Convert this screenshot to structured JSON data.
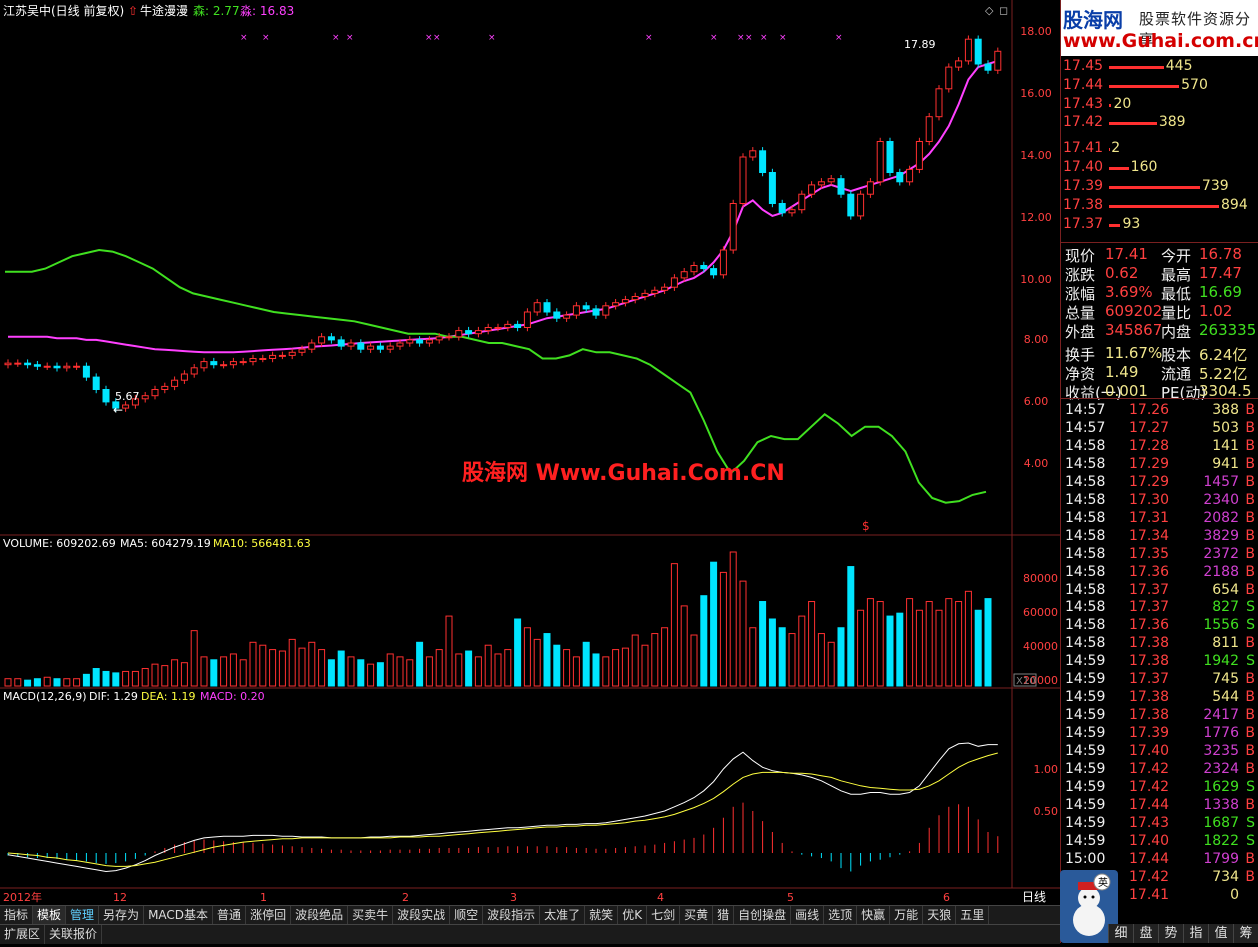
{
  "header": {
    "stock_name": "江苏吴中(日线 前复权)",
    "indicator_name": "牛途漫漫",
    "sen_label": "森: 2.77",
    "miao_label": "淼: 16.83"
  },
  "main_chart": {
    "y_ticks": [
      "18.00",
      "16.00",
      "14.00",
      "12.00",
      "10.00",
      "8.00",
      "6.00",
      "4.00"
    ],
    "low_label": "5.67",
    "high_label": "17.89",
    "watermark": "股海网 Www.Guhai.Com.CN",
    "dollar_mark": "$",
    "arrow_left": "←"
  },
  "volume_panel": {
    "label_prefix": "VOLUME: 609202.69",
    "ma5": "MA5: 604279.19",
    "ma10": "MA10: 566481.63",
    "y_ticks": [
      "80000",
      "60000",
      "40000",
      "20000"
    ],
    "unit": "X10"
  },
  "macd_panel": {
    "label": "MACD(12,26,9)",
    "dif": "DIF: 1.29",
    "dea": "DEA: 1.19",
    "macd": "MACD: 0.20",
    "y_ticks": [
      "1.00",
      "0.50"
    ]
  },
  "time_axis": [
    "2012年",
    "12",
    "1",
    "2",
    "3",
    "4",
    "5",
    "6"
  ],
  "period_label": "日线",
  "sidebar": {
    "logo_main": "股海网",
    "logo_tag": "股票软件资源分享",
    "logo_url": "www.Guhai.com.cn",
    "order_book": [
      {
        "price": "17.45",
        "vol": "445"
      },
      {
        "price": "17.44",
        "vol": "570"
      },
      {
        "price": "17.43",
        "vol": "20"
      },
      {
        "price": "17.42",
        "vol": "389"
      },
      {
        "price": "17.41",
        "vol": "2"
      },
      {
        "price": "17.40",
        "vol": "160"
      },
      {
        "price": "17.39",
        "vol": "739"
      },
      {
        "price": "17.38",
        "vol": "894"
      },
      {
        "price": "17.37",
        "vol": "93"
      }
    ],
    "quote": [
      {
        "l1": "现价",
        "v1": "17.41",
        "l2": "今开",
        "v2": "16.78"
      },
      {
        "l1": "涨跌",
        "v1": "0.62",
        "l2": "最高",
        "v2": "17.47"
      },
      {
        "l1": "涨幅",
        "v1": "3.69%",
        "l2": "最低",
        "v2": "16.69"
      },
      {
        "l1": "总量",
        "v1": "609202",
        "l2": "量比",
        "v2": "1.02"
      },
      {
        "l1": "外盘",
        "v1": "345867",
        "l2": "内盘",
        "v2": "263335"
      },
      {
        "l1": "换手",
        "v1": "11.67%",
        "l2": "股本",
        "v2": "6.24亿"
      },
      {
        "l1": "净资",
        "v1": "1.49",
        "l2": "流通",
        "v2": "5.22亿"
      },
      {
        "l1": "收益(一)",
        "v1": "0.001",
        "l2": "PE(动)",
        "v2": "3304.5"
      }
    ],
    "ticks": [
      {
        "t": "14:57",
        "p": "17.26",
        "v": "388",
        "s": "B"
      },
      {
        "t": "14:57",
        "p": "17.27",
        "v": "503",
        "s": "B"
      },
      {
        "t": "14:58",
        "p": "17.28",
        "v": "141",
        "s": "B"
      },
      {
        "t": "14:58",
        "p": "17.29",
        "v": "941",
        "s": "B"
      },
      {
        "t": "14:58",
        "p": "17.29",
        "v": "1457",
        "s": "B"
      },
      {
        "t": "14:58",
        "p": "17.30",
        "v": "2340",
        "s": "B"
      },
      {
        "t": "14:58",
        "p": "17.31",
        "v": "2082",
        "s": "B"
      },
      {
        "t": "14:58",
        "p": "17.34",
        "v": "3829",
        "s": "B"
      },
      {
        "t": "14:58",
        "p": "17.35",
        "v": "2372",
        "s": "B"
      },
      {
        "t": "14:58",
        "p": "17.36",
        "v": "2188",
        "s": "B"
      },
      {
        "t": "14:58",
        "p": "17.37",
        "v": "654",
        "s": "B"
      },
      {
        "t": "14:58",
        "p": "17.37",
        "v": "827",
        "s": "S"
      },
      {
        "t": "14:58",
        "p": "17.36",
        "v": "1556",
        "s": "S"
      },
      {
        "t": "14:58",
        "p": "17.38",
        "v": "811",
        "s": "B"
      },
      {
        "t": "14:59",
        "p": "17.38",
        "v": "1942",
        "s": "S"
      },
      {
        "t": "14:59",
        "p": "17.37",
        "v": "745",
        "s": "B"
      },
      {
        "t": "14:59",
        "p": "17.38",
        "v": "544",
        "s": "B"
      },
      {
        "t": "14:59",
        "p": "17.38",
        "v": "2417",
        "s": "B"
      },
      {
        "t": "14:59",
        "p": "17.39",
        "v": "1776",
        "s": "B"
      },
      {
        "t": "14:59",
        "p": "17.40",
        "v": "3235",
        "s": "B"
      },
      {
        "t": "14:59",
        "p": "17.42",
        "v": "2324",
        "s": "B"
      },
      {
        "t": "14:59",
        "p": "17.42",
        "v": "1629",
        "s": "S"
      },
      {
        "t": "14:59",
        "p": "17.44",
        "v": "1338",
        "s": "B"
      },
      {
        "t": "14:59",
        "p": "17.43",
        "v": "1687",
        "s": "S"
      },
      {
        "t": "14:59",
        "p": "17.40",
        "v": "1822",
        "s": "S"
      },
      {
        "t": "15:00",
        "p": "17.44",
        "v": "1799",
        "s": "B"
      },
      {
        "t": "",
        "p": "17.42",
        "v": "734",
        "s": "B"
      },
      {
        "t": "",
        "p": "17.41",
        "v": "0",
        "s": ""
      }
    ],
    "tabs": [
      "细",
      "盘",
      "势",
      "指",
      "值",
      "筹"
    ]
  },
  "toolbar": {
    "row1": [
      "指标",
      "模板",
      "管理",
      "另存为",
      "MACD基本",
      "普通",
      "涨停回",
      "波段绝品",
      "买卖牛",
      "波段实战",
      "顺空",
      "波段指示",
      "太准了",
      "就笑",
      "优K",
      "七剑",
      "买黄",
      "猎",
      "自创操盘",
      "画线",
      "选顶",
      "快赢",
      "万能",
      "天狼",
      "五里"
    ],
    "row2": [
      "扩展区",
      "关联报价"
    ]
  },
  "colors": {
    "up": "#ff3030",
    "down": "#00e5ff",
    "ma_magenta": "#ff40ff",
    "band_green": "#40e020",
    "grid_red": "#7a2020",
    "label_yellow": "#ffff40"
  },
  "chart_data": {
    "type": "candlestick",
    "price_axis": {
      "min": 2.0,
      "max": 19.0
    },
    "closes": [
      7.35,
      7.35,
      7.3,
      7.25,
      7.25,
      7.2,
      7.25,
      7.25,
      6.9,
      6.5,
      6.1,
      5.9,
      6.0,
      6.2,
      6.3,
      6.5,
      6.6,
      6.8,
      7.0,
      7.2,
      7.4,
      7.3,
      7.3,
      7.4,
      7.4,
      7.5,
      7.5,
      7.6,
      7.6,
      7.7,
      7.8,
      8.0,
      8.2,
      8.1,
      7.9,
      8.0,
      7.8,
      7.9,
      7.8,
      7.9,
      8.0,
      8.1,
      8.0,
      8.1,
      8.2,
      8.2,
      8.4,
      8.3,
      8.4,
      8.5,
      8.5,
      8.6,
      8.5,
      9.0,
      9.3,
      9.0,
      8.8,
      8.9,
      9.2,
      9.1,
      8.9,
      9.2,
      9.3,
      9.4,
      9.5,
      9.6,
      9.7,
      9.8,
      10.1,
      10.3,
      10.5,
      10.4,
      10.2,
      11.0,
      12.5,
      14.0,
      14.2,
      13.5,
      12.5,
      12.2,
      12.3,
      12.8,
      13.1,
      13.2,
      13.3,
      12.8,
      12.1,
      12.8,
      13.2,
      14.5,
      13.5,
      13.2,
      13.6,
      14.5,
      15.3,
      16.2,
      16.9,
      17.1,
      17.8,
      17.0,
      16.8,
      17.41
    ],
    "ma_magenta": [
      8.2,
      8.2,
      8.2,
      8.2,
      8.2,
      8.15,
      8.15,
      8.15,
      8.1,
      8.1,
      8.05,
      8.0,
      7.95,
      7.9,
      7.85,
      7.8,
      7.78,
      7.76,
      7.74,
      7.72,
      7.7,
      7.7,
      7.7,
      7.7,
      7.72,
      7.74,
      7.76,
      7.78,
      7.8,
      7.82,
      7.85,
      7.88,
      7.9,
      7.92,
      7.95,
      7.97,
      8.0,
      8.02,
      8.04,
      8.06,
      8.08,
      8.1,
      8.12,
      8.14,
      8.16,
      8.2,
      8.25,
      8.3,
      8.35,
      8.4,
      8.45,
      8.5,
      8.55,
      8.6,
      8.7,
      8.8,
      8.85,
      8.9,
      8.95,
      9.0,
      9.05,
      9.1,
      9.2,
      9.3,
      9.4,
      9.5,
      9.6,
      9.7,
      9.85,
      10.0,
      10.1,
      10.3,
      10.6,
      11.0,
      11.6,
      12.4,
      12.6,
      12.3,
      12.1,
      12.2,
      12.4,
      12.6,
      12.8,
      13.0,
      13.1,
      13.0,
      12.9,
      13.0,
      13.1,
      13.2,
      13.3,
      13.4,
      13.6,
      13.8,
      14.1,
      14.5,
      15.0,
      15.7,
      16.5,
      16.9,
      17.0,
      17.1
    ],
    "band_green": [
      10.3,
      10.3,
      10.3,
      10.4,
      10.6,
      10.8,
      10.9,
      11.0,
      10.95,
      10.8,
      10.6,
      10.4,
      10.1,
      9.8,
      9.6,
      9.5,
      9.4,
      9.3,
      9.2,
      9.1,
      9.0,
      8.95,
      8.9,
      8.85,
      8.8,
      8.75,
      8.7,
      8.6,
      8.5,
      8.4,
      8.3,
      8.3,
      8.3,
      8.2,
      8.2,
      8.1,
      8.0,
      8.0,
      7.9,
      7.8,
      7.5,
      7.5,
      7.6,
      7.8,
      7.7,
      7.7,
      7.6,
      7.5,
      7.3,
      7.0,
      6.7,
      6.4,
      5.5,
      4.5,
      3.8,
      4.2,
      4.8,
      5.0,
      4.9,
      4.9,
      5.3,
      5.7,
      5.4,
      5.0,
      5.3,
      5.3,
      5.0,
      4.5,
      3.5,
      3.0,
      2.85,
      2.9,
      3.1,
      3.2
    ],
    "volume_axis": {
      "min": 0,
      "max": 92000
    },
    "volumes": [
      5000,
      5000,
      4000,
      5000,
      6000,
      5000,
      5000,
      5000,
      8000,
      12000,
      10000,
      9000,
      10000,
      10000,
      12000,
      15000,
      14000,
      18000,
      16000,
      38000,
      20000,
      18000,
      20000,
      22000,
      18000,
      30000,
      28000,
      25000,
      24000,
      32000,
      26000,
      30000,
      25000,
      18000,
      24000,
      20000,
      18000,
      15000,
      16000,
      22000,
      20000,
      18000,
      30000,
      20000,
      25000,
      48000,
      22000,
      24000,
      20000,
      28000,
      22000,
      25000,
      46000,
      40000,
      32000,
      36000,
      28000,
      25000,
      20000,
      30000,
      22000,
      20000,
      25000,
      26000,
      35000,
      28000,
      36000,
      40000,
      84000,
      55000,
      35000,
      62000,
      85000,
      78000,
      92000,
      72000,
      40000,
      58000,
      46000,
      40000,
      36000,
      48000,
      58000,
      36000,
      30000,
      40000,
      82000,
      52000,
      60000,
      58000,
      48000,
      50000,
      60000,
      52000,
      58000,
      52000,
      60000,
      58000,
      65000,
      52000,
      60000
    ],
    "macd_axis": {
      "min": -0.35,
      "max": 1.45
    },
    "macd_hist": [
      -0.03,
      -0.04,
      -0.05,
      -0.06,
      -0.06,
      -0.07,
      -0.08,
      -0.09,
      -0.1,
      -0.12,
      -0.13,
      -0.12,
      -0.1,
      -0.07,
      -0.03,
      0.02,
      0.06,
      0.1,
      0.13,
      0.15,
      0.16,
      0.15,
      0.14,
      0.13,
      0.13,
      0.12,
      0.11,
      0.1,
      0.09,
      0.08,
      0.07,
      0.06,
      0.05,
      0.04,
      0.04,
      0.03,
      0.03,
      0.03,
      0.03,
      0.04,
      0.04,
      0.04,
      0.05,
      0.05,
      0.06,
      0.06,
      0.06,
      0.06,
      0.07,
      0.07,
      0.07,
      0.08,
      0.08,
      0.08,
      0.08,
      0.08,
      0.07,
      0.07,
      0.06,
      0.06,
      0.05,
      0.05,
      0.06,
      0.07,
      0.08,
      0.09,
      0.1,
      0.12,
      0.14,
      0.16,
      0.18,
      0.22,
      0.3,
      0.42,
      0.55,
      0.6,
      0.5,
      0.38,
      0.25,
      0.12,
      0.02,
      -0.02,
      -0.04,
      -0.06,
      -0.1,
      -0.18,
      -0.22,
      -0.15,
      -0.1,
      -0.08,
      -0.05,
      -0.02,
      0.02,
      0.12,
      0.3,
      0.45,
      0.55,
      0.58,
      0.55,
      0.4,
      0.25,
      0.2
    ],
    "dif": [
      -0.02,
      -0.04,
      -0.06,
      -0.08,
      -0.1,
      -0.12,
      -0.14,
      -0.16,
      -0.18,
      -0.2,
      -0.22,
      -0.21,
      -0.18,
      -0.14,
      -0.09,
      -0.03,
      0.02,
      0.07,
      0.11,
      0.15,
      0.18,
      0.19,
      0.2,
      0.2,
      0.2,
      0.21,
      0.21,
      0.21,
      0.2,
      0.2,
      0.19,
      0.19,
      0.19,
      0.18,
      0.18,
      0.18,
      0.18,
      0.19,
      0.19,
      0.2,
      0.2,
      0.2,
      0.21,
      0.22,
      0.23,
      0.24,
      0.25,
      0.26,
      0.27,
      0.28,
      0.29,
      0.3,
      0.3,
      0.31,
      0.32,
      0.33,
      0.33,
      0.34,
      0.34,
      0.35,
      0.35,
      0.36,
      0.38,
      0.4,
      0.42,
      0.44,
      0.47,
      0.5,
      0.55,
      0.6,
      0.66,
      0.74,
      0.85,
      1.0,
      1.12,
      1.2,
      1.1,
      1.02,
      0.98,
      0.96,
      0.95,
      0.93,
      0.9,
      0.86,
      0.8,
      0.74,
      0.7,
      0.7,
      0.72,
      0.72,
      0.7,
      0.7,
      0.72,
      0.8,
      0.95,
      1.1,
      1.24,
      1.3,
      1.31,
      1.27,
      1.29,
      1.29
    ],
    "dea": [
      0.0,
      -0.01,
      -0.02,
      -0.03,
      -0.05,
      -0.06,
      -0.08,
      -0.09,
      -0.11,
      -0.13,
      -0.15,
      -0.16,
      -0.16,
      -0.15,
      -0.13,
      -0.11,
      -0.08,
      -0.05,
      -0.02,
      0.01,
      0.04,
      0.07,
      0.09,
      0.11,
      0.13,
      0.14,
      0.15,
      0.16,
      0.17,
      0.17,
      0.18,
      0.18,
      0.18,
      0.18,
      0.18,
      0.18,
      0.18,
      0.18,
      0.18,
      0.18,
      0.19,
      0.19,
      0.19,
      0.2,
      0.2,
      0.21,
      0.22,
      0.23,
      0.24,
      0.25,
      0.26,
      0.27,
      0.28,
      0.29,
      0.3,
      0.31,
      0.31,
      0.32,
      0.32,
      0.33,
      0.33,
      0.34,
      0.35,
      0.36,
      0.38,
      0.39,
      0.41,
      0.43,
      0.46,
      0.5,
      0.54,
      0.59,
      0.65,
      0.73,
      0.82,
      0.9,
      0.94,
      0.96,
      0.96,
      0.96,
      0.95,
      0.95,
      0.94,
      0.92,
      0.9,
      0.86,
      0.83,
      0.8,
      0.78,
      0.77,
      0.76,
      0.75,
      0.75,
      0.76,
      0.8,
      0.86,
      0.94,
      1.02,
      1.08,
      1.12,
      1.16,
      1.19
    ]
  }
}
